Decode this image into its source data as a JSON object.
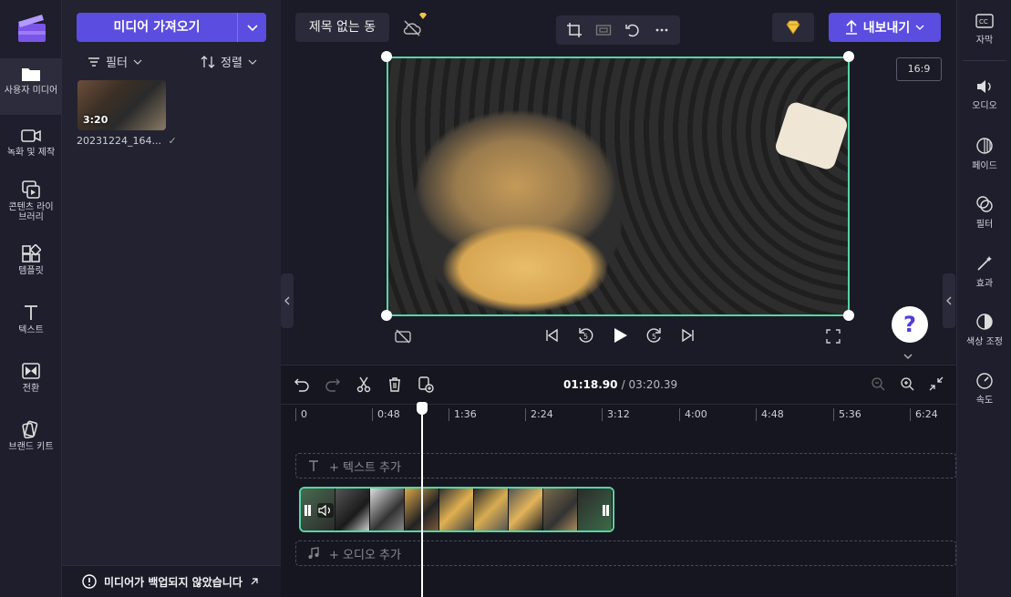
{
  "rail": {
    "items": [
      {
        "label": "사용자 미디어",
        "icon": "folder-icon"
      },
      {
        "label": "녹화 및 제작",
        "icon": "camera-icon"
      },
      {
        "label": "콘텐츠 라이브러리",
        "icon": "library-icon"
      },
      {
        "label": "템플릿",
        "icon": "template-icon"
      },
      {
        "label": "텍스트",
        "icon": "text-icon"
      },
      {
        "label": "전환",
        "icon": "transition-icon"
      },
      {
        "label": "브랜드 키트",
        "icon": "brand-kit-icon"
      }
    ]
  },
  "media": {
    "import_label": "미디어 가져오기",
    "filter_label": "필터",
    "sort_label": "정렬",
    "thumb_duration": "3:20",
    "thumb_name": "20231224_164...",
    "backup_text": "미디어가 백업되지 않았습니다"
  },
  "header": {
    "project_title": "제목 없는 동",
    "export_label": "내보내기",
    "aspect_ratio": "16:9"
  },
  "timeline": {
    "current_time": "01:18.90",
    "total_time": "/ 03:20.39",
    "ticks": [
      "0",
      "0:48",
      "1:36",
      "2:24",
      "3:12",
      "4:00",
      "4:48",
      "5:36",
      "6:24"
    ],
    "text_track": "+ 텍스트 추가",
    "audio_track": "+ 오디오 추가"
  },
  "props": {
    "items": [
      {
        "label": "자막",
        "icon": "captions-icon"
      },
      {
        "label": "오디오",
        "icon": "audio-icon"
      },
      {
        "label": "페이드",
        "icon": "fade-icon"
      },
      {
        "label": "필터",
        "icon": "filter-icon"
      },
      {
        "label": "효과",
        "icon": "effects-icon"
      },
      {
        "label": "색상 조정",
        "icon": "color-adjust-icon"
      },
      {
        "label": "속도",
        "icon": "speed-icon"
      }
    ]
  },
  "colors": {
    "accent": "#5b4de0",
    "selection": "#57d4a4",
    "help_text": "?"
  }
}
